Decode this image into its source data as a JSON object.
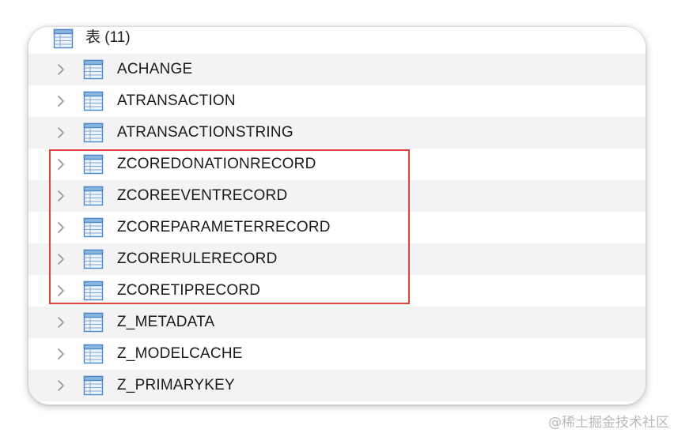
{
  "section": {
    "title": "表 (11)",
    "icon": "table-icon"
  },
  "tables": [
    {
      "name": "ACHANGE",
      "icon": "table-icon",
      "expand_icon": "chevron-right-icon"
    },
    {
      "name": "ATRANSACTION",
      "icon": "table-icon",
      "expand_icon": "chevron-right-icon"
    },
    {
      "name": "ATRANSACTIONSTRING",
      "icon": "table-icon",
      "expand_icon": "chevron-right-icon"
    },
    {
      "name": "ZCOREDONATIONRECORD",
      "icon": "table-icon",
      "expand_icon": "chevron-right-icon"
    },
    {
      "name": "ZCOREEVENTRECORD",
      "icon": "table-icon",
      "expand_icon": "chevron-right-icon"
    },
    {
      "name": "ZCOREPARAMETERRECORD",
      "icon": "table-icon",
      "expand_icon": "chevron-right-icon"
    },
    {
      "name": "ZCORERULERECORD",
      "icon": "table-icon",
      "expand_icon": "chevron-right-icon"
    },
    {
      "name": "ZCORETIPRECORD",
      "icon": "table-icon",
      "expand_icon": "chevron-right-icon"
    },
    {
      "name": "Z_METADATA",
      "icon": "table-icon",
      "expand_icon": "chevron-right-icon"
    },
    {
      "name": "Z_MODELCACHE",
      "icon": "table-icon",
      "expand_icon": "chevron-right-icon"
    },
    {
      "name": "Z_PRIMARYKEY",
      "icon": "table-icon",
      "expand_icon": "chevron-right-icon"
    }
  ],
  "colors": {
    "highlight_border": "#e0443a",
    "row_alt_background": "#f3f3f3",
    "icon_blue": "#4a86c8"
  },
  "watermark": "@稀土掘金技术社区"
}
